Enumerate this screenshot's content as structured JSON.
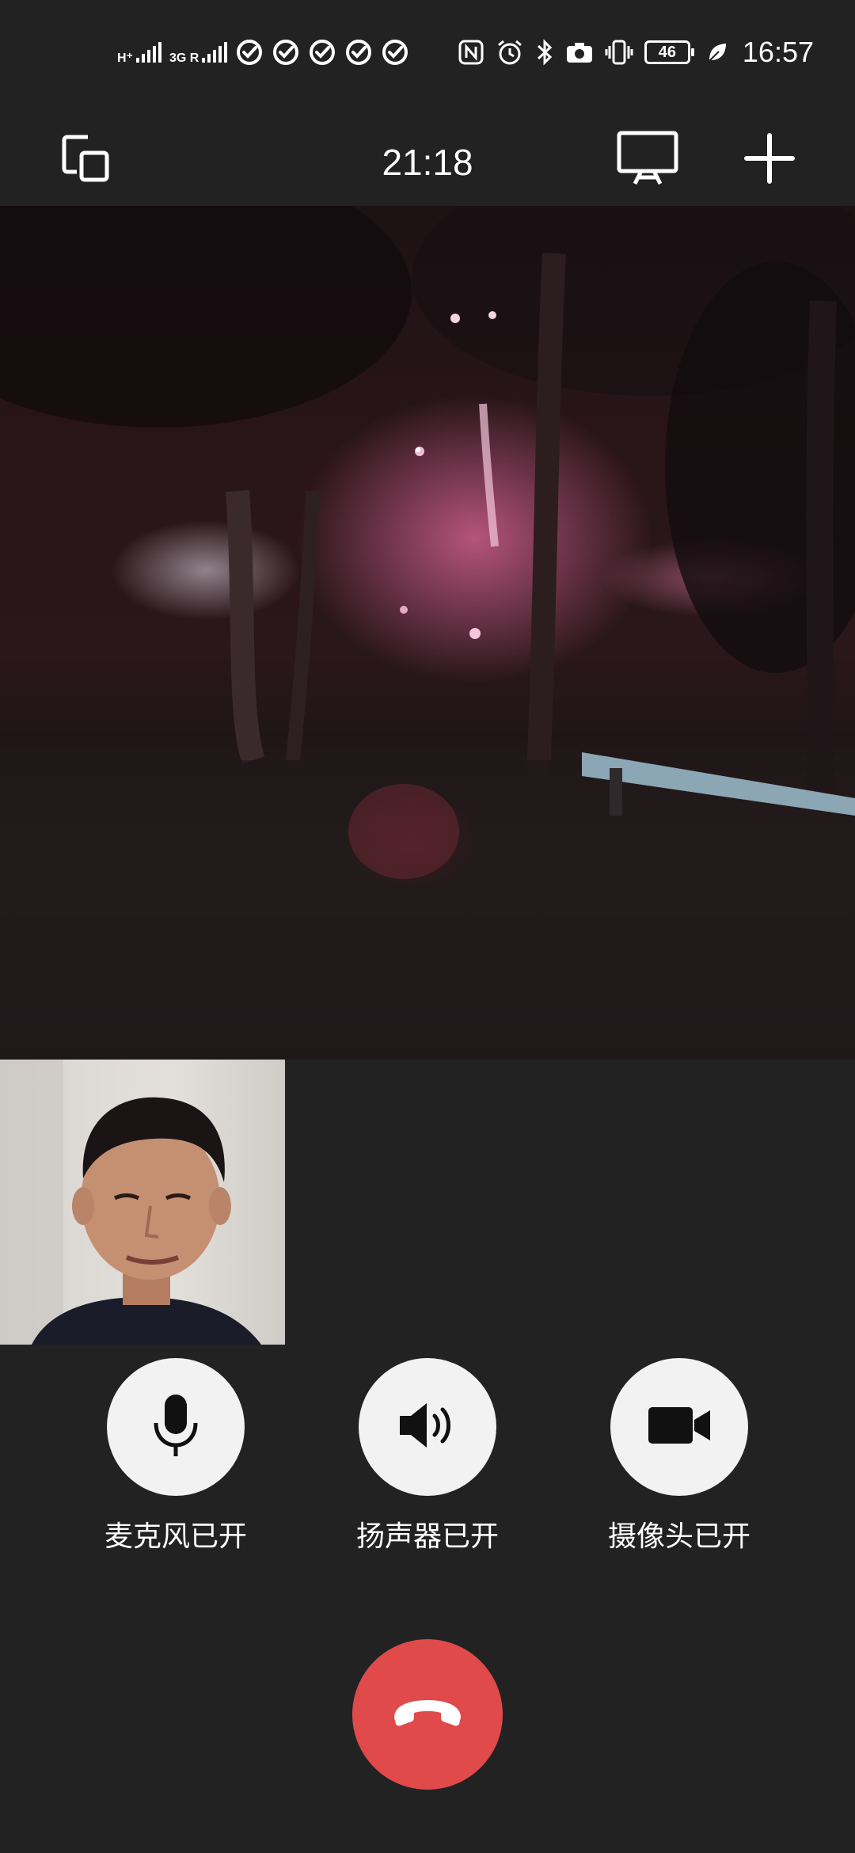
{
  "status_bar": {
    "network1_label": "H⁺",
    "network2_label": "3G R",
    "battery_level": "46",
    "time": "16:57",
    "icons": [
      "signal-icon",
      "signal-icon",
      "check-circle-icon",
      "nfc-icon",
      "alarm-icon",
      "bluetooth-icon",
      "camera-icon",
      "vibrate-icon",
      "battery-icon",
      "leaf-icon"
    ]
  },
  "top_bar": {
    "call_duration": "21:18",
    "icons": [
      "switch-window-icon",
      "screen-cast-icon",
      "add-icon"
    ]
  },
  "controls": {
    "microphone": {
      "label": "麦克风已开",
      "icon": "microphone-icon"
    },
    "speaker": {
      "label": "扬声器已开",
      "icon": "speaker-icon"
    },
    "camera": {
      "label": "摄像头已开",
      "icon": "video-camera-icon"
    },
    "hangup": {
      "icon": "hang-up-icon"
    }
  },
  "colors": {
    "background": "#222222",
    "control_button": "#f2f2f2",
    "hangup_button": "#e04a4a"
  }
}
